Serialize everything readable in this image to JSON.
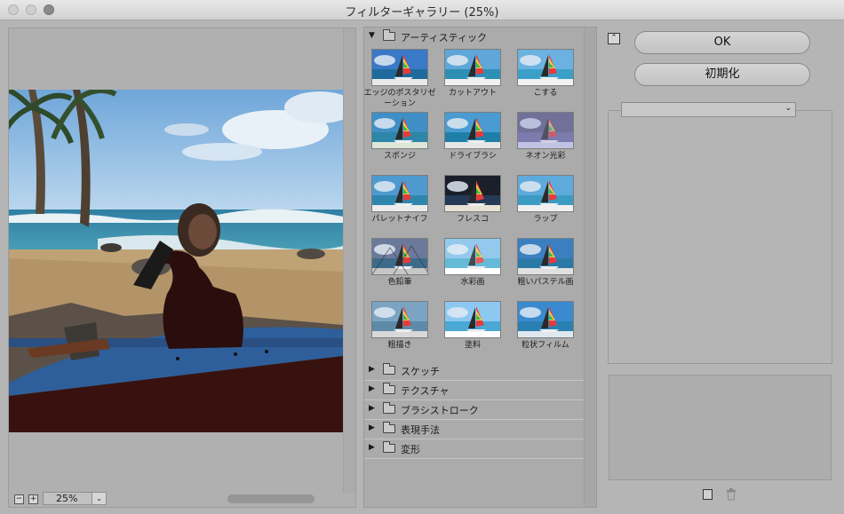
{
  "window": {
    "title": "フィルターギャラリー (25%)"
  },
  "preview": {
    "zoom": "25%",
    "zoom_out": "−",
    "zoom_in": "+"
  },
  "categories": [
    {
      "label": "アーティスティック",
      "expanded": true,
      "tri": "▼"
    },
    {
      "label": "スケッチ",
      "expanded": false,
      "tri": "▶"
    },
    {
      "label": "テクスチャ",
      "expanded": false,
      "tri": "▶"
    },
    {
      "label": "ブラシストローク",
      "expanded": false,
      "tri": "▶"
    },
    {
      "label": "表現手法",
      "expanded": false,
      "tri": "▶"
    },
    {
      "label": "変形",
      "expanded": false,
      "tri": "▶"
    }
  ],
  "filters": [
    {
      "label": "エッジのポスタリゼーション"
    },
    {
      "label": "カットアウト"
    },
    {
      "label": "こする"
    },
    {
      "label": "スポンジ"
    },
    {
      "label": "ドライブラシ"
    },
    {
      "label": "ネオン光彩"
    },
    {
      "label": "パレットナイフ"
    },
    {
      "label": "フレスコ"
    },
    {
      "label": "ラップ"
    },
    {
      "label": "色鉛筆"
    },
    {
      "label": "水彩画"
    },
    {
      "label": "粗いパステル画"
    },
    {
      "label": "粗描き"
    },
    {
      "label": "塗料"
    },
    {
      "label": "粒状フィルム"
    }
  ],
  "buttons": {
    "ok": "OK",
    "reset": "初期化"
  },
  "icons": {
    "collapse": "collapse-panel-icon",
    "new_layer": "new-effect-layer-icon",
    "delete": "trash-icon"
  }
}
